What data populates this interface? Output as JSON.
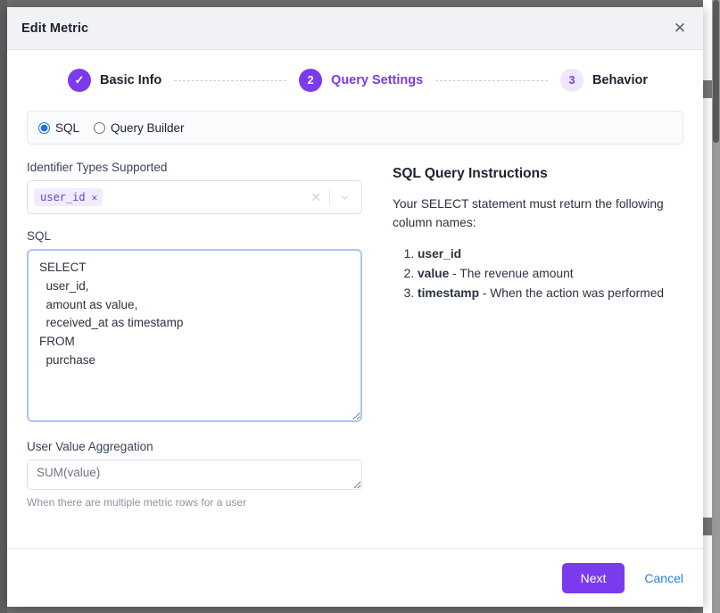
{
  "modal": {
    "title": "Edit Metric",
    "close_icon": "close-icon"
  },
  "stepper": {
    "steps": [
      {
        "badge": "✓",
        "label": "Basic Info",
        "state": "done"
      },
      {
        "badge": "2",
        "label": "Query Settings",
        "state": "current"
      },
      {
        "badge": "3",
        "label": "Behavior",
        "state": "upcoming"
      }
    ]
  },
  "source": {
    "options": [
      {
        "label": "SQL",
        "selected": true
      },
      {
        "label": "Query Builder",
        "selected": false
      }
    ]
  },
  "identifier": {
    "label": "Identifier Types Supported",
    "tags": [
      {
        "text": "user_id",
        "remove_icon": "✕"
      }
    ],
    "clear_icon": "✕",
    "chevron_icon": "chevron-down-icon"
  },
  "sql": {
    "label": "SQL",
    "value": "SELECT\n  user_id,\n  amount as value,\n  received_at as timestamp\nFROM\n  purchase",
    "placeholder": ""
  },
  "aggregation": {
    "label": "User Value Aggregation",
    "placeholder": "SUM(value)",
    "value": "",
    "hint": "When there are multiple metric rows for a user"
  },
  "instructions": {
    "title": "SQL Query Instructions",
    "intro": "Your SELECT statement must return the following column names:",
    "items": [
      {
        "name": "user_id",
        "desc": ""
      },
      {
        "name": "value",
        "desc": " - The revenue amount"
      },
      {
        "name": "timestamp",
        "desc": " - When the action was performed"
      }
    ]
  },
  "footer": {
    "next_label": "Next",
    "cancel_label": "Cancel"
  },
  "colors": {
    "accent_purple": "#7c3aed",
    "link_blue": "#2b7de9",
    "radio_blue": "#1a73e8",
    "tag_bg": "#f0ecfd",
    "header_bg": "#f0f2f6",
    "focus_border": "#a8c7f5"
  }
}
